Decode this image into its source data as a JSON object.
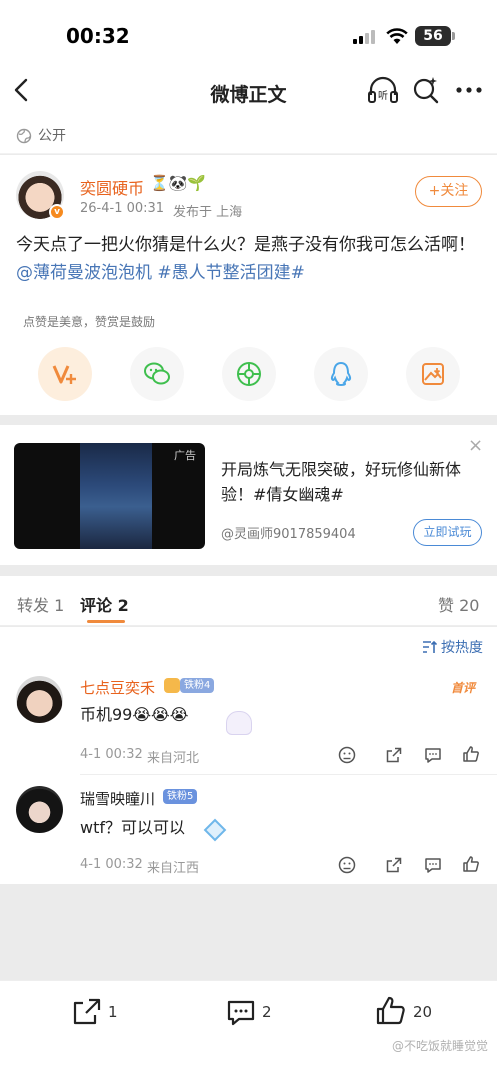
{
  "status_bar": {
    "time": "00:32",
    "battery": "56"
  },
  "nav": {
    "title": "微博正文"
  },
  "visibility": {
    "label": "公开"
  },
  "post": {
    "author": "奕圆硬币",
    "author_emojis": "⏳🐼🌱",
    "verified_mark": "v",
    "time": "26-4-1 00:31",
    "location": "发布于 上海",
    "follow_label": "+关注",
    "text_plain": "今天点了一把火你猜是什么火？是燕子没有你我可怎么活啊！",
    "mention": "@薄荷曼波泡泡机",
    "hashtag": "#愚人节整活团建#",
    "reward_tip": "点赞是美意，赞赏是鼓励"
  },
  "ad": {
    "tag": "广告",
    "text": "开局炼气无限突破，好玩修仙新体验！#倩女幽魂#",
    "source": "@灵画师9017859404",
    "button": "立即试玩",
    "close": "×"
  },
  "tabs": {
    "repost": "转发 1",
    "comment": "评论 2",
    "like": "赞 20"
  },
  "sort": {
    "label": "按热度"
  },
  "comments": [
    {
      "name": "七点豆奕禾",
      "badge": "铁粉4",
      "first_tag": "首评",
      "text": "币机99😭😭😭",
      "time": "4-1 00:32",
      "location": "来自河北"
    },
    {
      "name": "瑞雪映瞳川",
      "badge": "铁粉5",
      "text": "wtf？可以可以",
      "time": "4-1 00:32",
      "location": "来自江西"
    }
  ],
  "bottom": {
    "repost_count": "1",
    "comment_count": "2",
    "like_count": "20",
    "watermark": "@不吃饭就睡觉觉"
  },
  "colors": {
    "accent_orange": "#f08a3c",
    "link_blue": "#4876b6",
    "author_orange": "#e8631e"
  }
}
